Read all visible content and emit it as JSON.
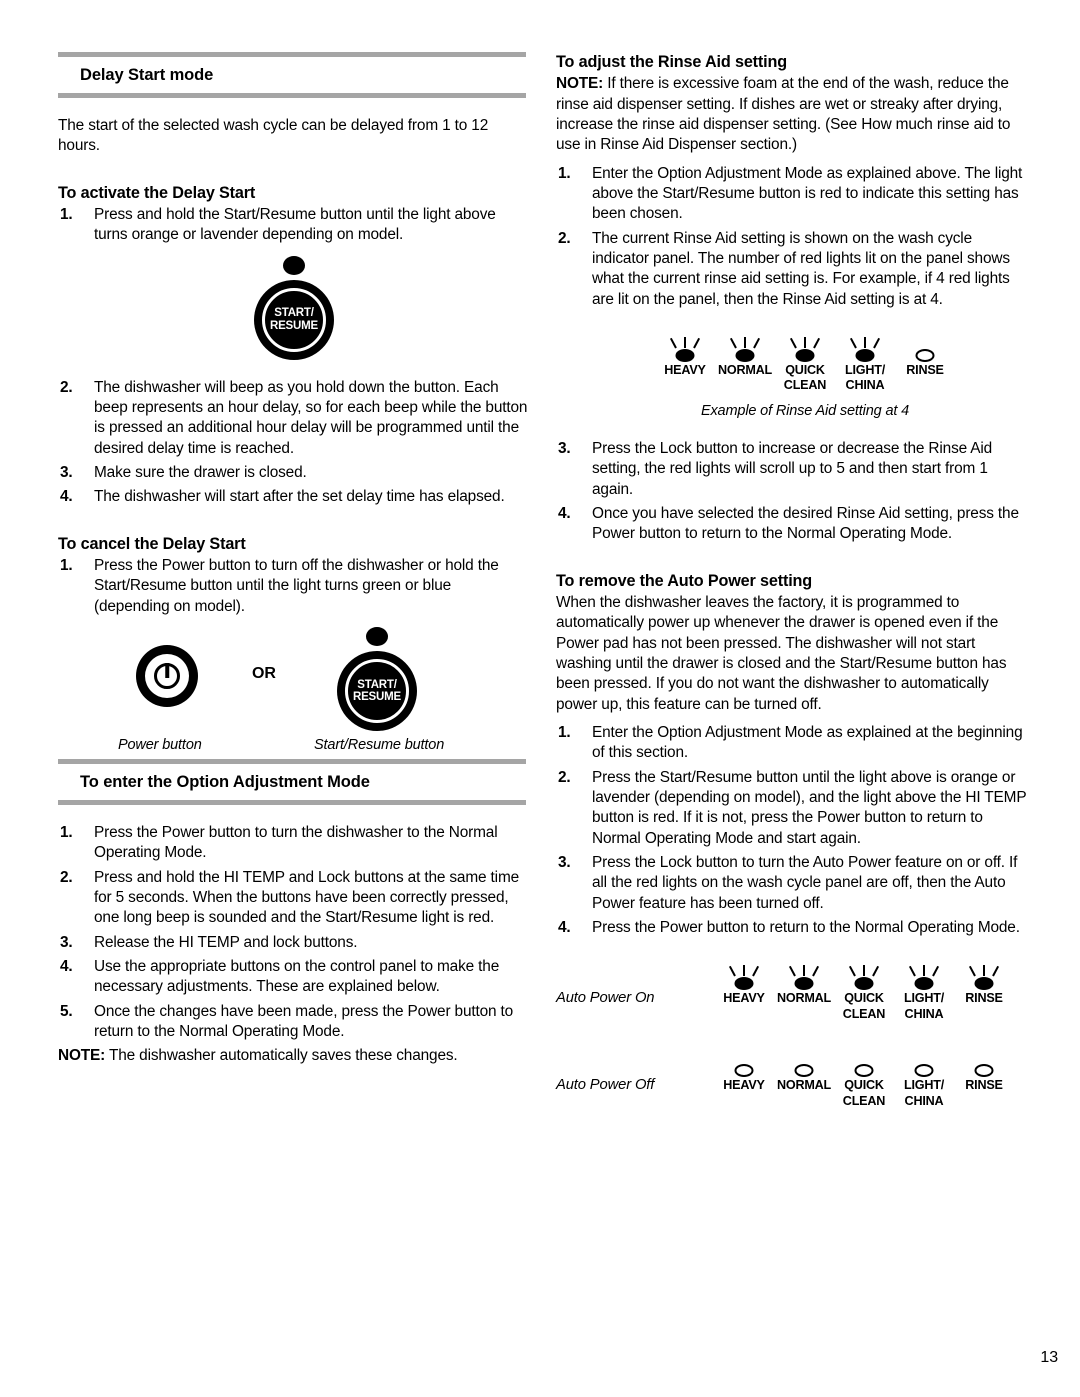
{
  "page": {
    "number": "13"
  },
  "left_column": {
    "section1": {
      "heading": "Delay Start mode",
      "intro": "The start of the selected wash cycle can be delayed from 1 to 12 hours.",
      "activate": {
        "heading": "To activate the Delay Start",
        "steps": [
          {
            "num": "1.",
            "text": "Press and hold the Start/Resume button until the light above turns orange or lavender depending on model."
          }
        ],
        "figure": {
          "name": "start-resume-button",
          "label_line1": "START/",
          "label_line2": "RESUME"
        },
        "steps_after": [
          {
            "num": "2.",
            "text": "The dishwasher will beep as you hold down the button. Each  beep  represents an hour delay, so for each beep while the button is pressed an additional hour delay will be programmed until the desired delay time is reached."
          },
          {
            "num": "3.",
            "text": "Make sure the drawer is closed."
          },
          {
            "num": "4.",
            "text": "The dishwasher will start after the set delay time has elapsed."
          }
        ]
      },
      "cancel": {
        "heading": "To cancel the Delay Start",
        "steps": [
          {
            "num": "1.",
            "text": "Press the Power button to turn off the dishwasher or hold the Start/Resume button until the light turns green or blue (depending on model)."
          }
        ],
        "figure": {
          "or_text": "OR",
          "power_caption": "Power button",
          "start_caption": "Start/Resume button",
          "start_label_line1": "START/",
          "start_label_line2": "RESUME"
        }
      }
    },
    "section2": {
      "heading": "To enter the Option Adjustment Mode",
      "steps": [
        {
          "num": "1.",
          "text": "Press the Power button to turn the dishwasher to the Normal Operating Mode."
        },
        {
          "num": "2.",
          "text": "Press and hold the HI TEMP and Lock buttons at the same time for 5 seconds. When the buttons have been correctly pressed, one long beep is sounded and the Start/Resume light is red."
        },
        {
          "num": "3.",
          "text": "Release the HI TEMP and lock buttons."
        },
        {
          "num": "4.",
          "text": "Use the appropriate buttons on the control panel to make the necessary adjustments. These are explained below."
        },
        {
          "num": "5.",
          "text": "Once the changes have been made, press the Power button to return to the Normal Operating Mode."
        }
      ],
      "note_label": "NOTE:",
      "note_text": " The dishwasher automatically saves these changes."
    }
  },
  "right_column": {
    "rinse_aid": {
      "heading": "To adjust the Rinse Aid setting",
      "note_label": "NOTE:",
      "note_text": " If there is excessive foam at the end of the wash, reduce the rinse aid dispenser setting. If dishes are wet or streaky after drying, increase the rinse aid dispenser setting. (See  How much rinse aid to use  in  Rinse Aid Dispenser  section.)",
      "steps_before": [
        {
          "num": "1.",
          "text": "Enter the Option Adjustment Mode as explained above. The light above the Start/Resume button is red to indicate this setting has been chosen."
        },
        {
          "num": "2.",
          "text": "The current Rinse Aid setting is shown on the wash cycle indicator panel. The number of red lights lit on the panel shows what the current rinse aid setting is. For example, if 4 red lights are lit on the panel, then the Rinse Aid setting is at 4."
        }
      ],
      "panel": {
        "lamps": [
          {
            "label": "HEAVY",
            "label2": "",
            "state": "on"
          },
          {
            "label": "NORMAL",
            "label2": "",
            "state": "on"
          },
          {
            "label": "QUICK",
            "label2": "CLEAN",
            "state": "on"
          },
          {
            "label": "LIGHT/",
            "label2": "CHINA",
            "state": "on"
          },
          {
            "label": "RINSE",
            "label2": "",
            "state": "off"
          }
        ],
        "caption": "Example of Rinse Aid setting at 4"
      },
      "steps_after": [
        {
          "num": "3.",
          "text": "Press the Lock button to increase or decrease the Rinse Aid setting, the red lights will scroll up to 5 and then start from 1 again."
        },
        {
          "num": "4.",
          "text": "Once you have selected the desired Rinse Aid setting, press the Power button to return to the Normal Operating Mode."
        }
      ]
    },
    "auto_power": {
      "heading": "To remove the Auto Power setting",
      "intro": "When the dishwasher leaves the factory, it is programmed to automatically power up whenever the drawer is opened even if the Power pad has not been pressed. The dishwasher will not start washing until the drawer is closed and the Start/Resume button has been pressed. If you do not want the dishwasher to automatically power up, this feature can be turned off.",
      "steps": [
        {
          "num": "1.",
          "text": "Enter the Option Adjustment Mode as explained at the beginning of this section."
        },
        {
          "num": "2.",
          "text": "Press the Start/Resume button until the light above is orange or lavender (depending on model), and the light above the HI TEMP button is red. If it is not, press the Power button to return to Normal Operating Mode and start again."
        },
        {
          "num": "3.",
          "text": "Press the Lock button to turn the Auto Power feature on or off. If all the red lights on the wash cycle panel are off, then the Auto Power feature has been turned off."
        },
        {
          "num": "4.",
          "text": "Press the Power button to return to the Normal Operating Mode."
        }
      ],
      "on_panel": {
        "label": "Auto Power On",
        "lamps": [
          {
            "label": "HEAVY",
            "label2": "",
            "state": "on"
          },
          {
            "label": "NORMAL",
            "label2": "",
            "state": "on"
          },
          {
            "label": "QUICK",
            "label2": "CLEAN",
            "state": "on"
          },
          {
            "label": "LIGHT/",
            "label2": "CHINA",
            "state": "on"
          },
          {
            "label": "RINSE",
            "label2": "",
            "state": "on"
          }
        ]
      },
      "off_panel": {
        "label": "Auto Power Off",
        "lamps": [
          {
            "label": "HEAVY",
            "label2": "",
            "state": "off"
          },
          {
            "label": "NORMAL",
            "label2": "",
            "state": "off"
          },
          {
            "label": "QUICK",
            "label2": "CLEAN",
            "state": "off"
          },
          {
            "label": "LIGHT/",
            "label2": "CHINA",
            "state": "off"
          },
          {
            "label": "RINSE",
            "label2": "",
            "state": "off"
          }
        ]
      }
    }
  },
  "colors": {
    "rule": "#a5a5a5",
    "text": "#000000",
    "background": "#ffffff"
  }
}
